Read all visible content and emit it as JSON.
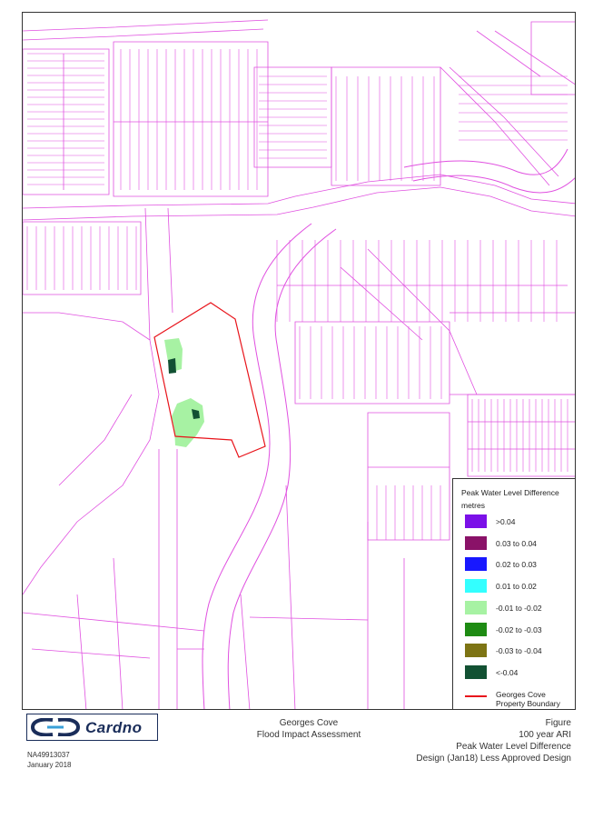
{
  "legend": {
    "title": "Peak Water Level Difference",
    "units": "metres",
    "items": [
      {
        "label": ">0.04",
        "color": "#7b10e8"
      },
      {
        "label": "0.03 to 0.04",
        "color": "#8a1268"
      },
      {
        "label": "0.02 to 0.03",
        "color": "#1818ff"
      },
      {
        "label": "0.01 to 0.02",
        "color": "#33ffff"
      },
      {
        "label": "-0.01 to -0.02",
        "color": "#a7f2a3"
      },
      {
        "label": "-0.02 to -0.03",
        "color": "#1e8b13"
      },
      {
        "label": "-0.03 to -0.04",
        "color": "#7d7414"
      },
      {
        "label": "<-0.04",
        "color": "#125133"
      }
    ],
    "boundary_label_line1": "Georges Cove",
    "boundary_label_line2": "Property Boundary",
    "boundary_color": "#e8141b"
  },
  "map_colors": {
    "cadastre": "#e050e0",
    "boundary": "#e8141b",
    "impact_light": "#a7f2a3",
    "impact_dark": "#125133"
  },
  "logo": {
    "text": "Cardno",
    "color": "#1a2d5a"
  },
  "footer": {
    "ref_code": "NA49913037",
    "date": "January 2018",
    "project_title": "Georges Cove",
    "project_subtitle": "Flood Impact Assessment",
    "figure_label": "Figure",
    "figure_line1": "100 year ARI",
    "figure_line2": "Peak Water Level Difference",
    "figure_line3": "Design (Jan18) Less Approved Design"
  }
}
